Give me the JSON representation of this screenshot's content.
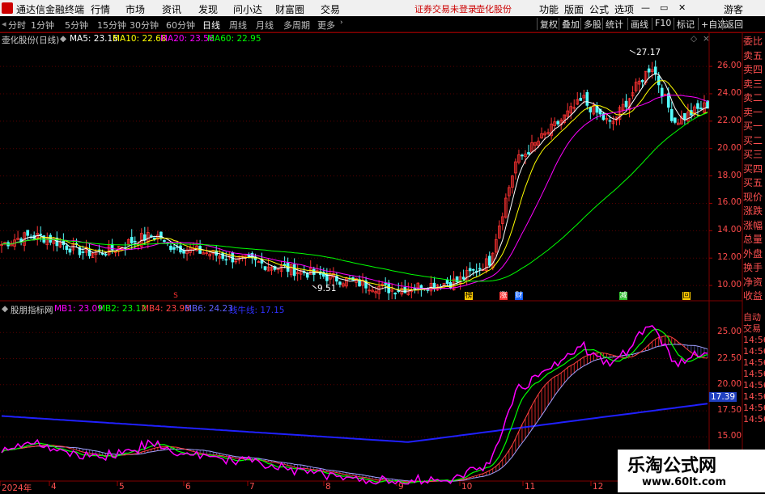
{
  "app": {
    "title": "通达信金融终端"
  },
  "menu": [
    "行情",
    "市场",
    "资讯",
    "发现",
    "问小达",
    "财富圈",
    "交易"
  ],
  "menu_warn": "证券交易未登录",
  "menu_stock": "壶化股份",
  "menu_right": [
    "功能",
    "版面",
    "公式",
    "选项"
  ],
  "user": "游客",
  "periods": [
    "分时",
    "1分钟",
    "5分钟",
    "15分钟",
    "30分钟",
    "60分钟",
    "日线",
    "周线",
    "月线",
    "多周期",
    "更多"
  ],
  "toolbar_right": [
    "复权",
    "叠加",
    "多股",
    "统计",
    "画线",
    "F10",
    "标记",
    "+自选",
    "返回"
  ],
  "main": {
    "title": "壶化股份(日线)",
    "ma": [
      {
        "label": "MA5: 23.16",
        "color": "#ffffff"
      },
      {
        "label": "MA10: 22.68",
        "color": "#ffff00"
      },
      {
        "label": "MA20: 23.56",
        "color": "#ff00ff"
      },
      {
        "label": "MA60: 22.95",
        "color": "#00ff00"
      }
    ],
    "y_ticks": [
      "26.00",
      "24.00",
      "22.00",
      "20.00",
      "18.00",
      "16.00",
      "14.00",
      "12.00",
      "10.00"
    ],
    "high_label": "27.17",
    "low_label": "9.51",
    "side": [
      "委比",
      "卖五",
      "卖四",
      "卖三",
      "卖二",
      "卖一",
      "买一",
      "买二",
      "买三",
      "买四",
      "买五",
      "现价",
      "涨跌",
      "涨幅",
      "总量",
      "外盘",
      "换手",
      "净资",
      "收益"
    ],
    "events": [
      "S",
      "榜",
      "涨",
      "财",
      "减",
      "回"
    ]
  },
  "sub": {
    "title": "股朋指标网",
    "lines": [
      {
        "label": "MB1: 23.09",
        "color": "#ff00ff"
      },
      {
        "label": "MB2: 23.12",
        "color": "#00ff00"
      },
      {
        "label": "MB4: 23.98",
        "color": "#ff4040"
      },
      {
        "label": "MB6: 24.23",
        "color": "#6060ff"
      },
      {
        "label": "线牛线: 17.15",
        "color": "#3030ff"
      }
    ],
    "y_ticks": [
      "25.00",
      "22.50",
      "20.00",
      "17.50",
      "15.00"
    ],
    "current": "17.39",
    "side": [
      "自动",
      "交易",
      "14:56",
      "14:56",
      "14:56",
      "14:56",
      "14:56",
      "14:56",
      "14:56",
      "14:56"
    ]
  },
  "x_labels": [
    "2024年",
    "4",
    "5",
    "6",
    "7",
    "8",
    "9",
    "10",
    "11",
    "12"
  ],
  "watermark": {
    "name": "乐淘公式网",
    "url": "www.60lt.com"
  }
}
